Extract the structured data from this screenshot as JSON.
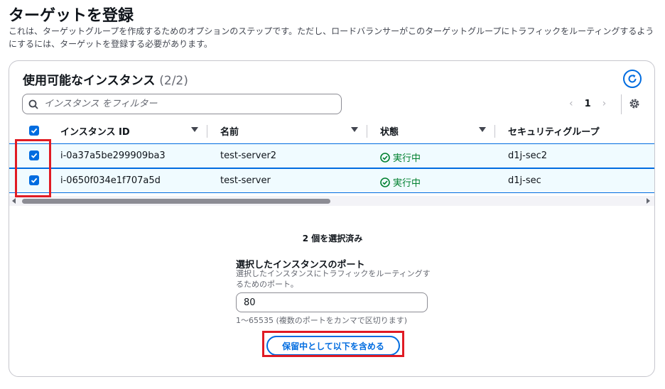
{
  "page": {
    "title": "ターゲットを登録",
    "description": "これは、ターゲットグループを作成するためのオプションのステップです。ただし、ロードバランサーがこのターゲットグループにトラフィックをルーティングするようにするには、ターゲットを登録する必要があります。"
  },
  "panel": {
    "title": "使用可能なインスタンス",
    "count": "(2/2)",
    "refresh_icon": "refresh-icon"
  },
  "search": {
    "placeholder": "インスタンス をフィルター",
    "value": ""
  },
  "pagination": {
    "prev": "‹",
    "page": "1",
    "next": "›"
  },
  "table": {
    "columns": [
      "インスタンス ID",
      "名前",
      "状態",
      "セキュリティグループ"
    ],
    "rows": [
      {
        "checked": true,
        "instance_id": "i-0a37a5be299909ba3",
        "name": "test-server2",
        "status": "実行中",
        "security_group": "d1j-sec2"
      },
      {
        "checked": true,
        "instance_id": "i-0650f034e1f707a5d",
        "name": "test-server",
        "status": "実行中",
        "security_group": "d1j-sec"
      }
    ]
  },
  "selection": {
    "summary": "2 個を選択済み"
  },
  "port": {
    "label": "選択したインスタンスのポート",
    "description": "選択したインスタンスにトラフィックをルーティングするためのポート。",
    "value": "80",
    "hint": "1〜65535 (複数のポートをカンマで区切ります)"
  },
  "actions": {
    "include_pending": "保留中として以下を含める"
  },
  "colors": {
    "accent": "#006ce0",
    "success": "#00802f",
    "highlight": "#e01b24",
    "selected_row_bg": "#f0fbff"
  }
}
